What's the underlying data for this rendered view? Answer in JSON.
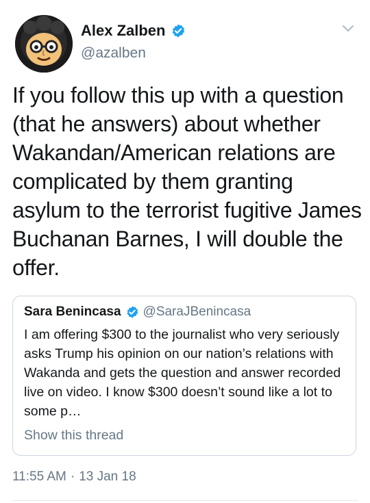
{
  "author": {
    "display_name": "Alex Zalben",
    "handle": "@azalben",
    "verified": true
  },
  "tweet": {
    "text": "If you follow this up with a question (that he answers) about whether Wakandan/American relations are complicated by them granting asylum to the terrorist fugitive James Buchanan Barnes, I will double the offer."
  },
  "quoted_tweet": {
    "display_name": "Sara Benincasa",
    "handle": "@SaraJBenincasa",
    "verified": true,
    "text": "I am offering $300 to the journalist who very seriously asks Trump his opinion on our nation’s relations with Wakanda and gets the question and answer recorded live on video. I know $300 doesn’t sound like a lot to some p…",
    "link_label": "Show this thread"
  },
  "timestamp": {
    "time": "11:55 AM",
    "separator": "·",
    "date": "13 Jan 18"
  },
  "colors": {
    "verified_blue": "#1da1f2",
    "secondary_text": "#657786",
    "border": "#ccd6dd"
  },
  "icons": {
    "verified": "verified-badge-icon",
    "more": "chevron-down-icon"
  }
}
